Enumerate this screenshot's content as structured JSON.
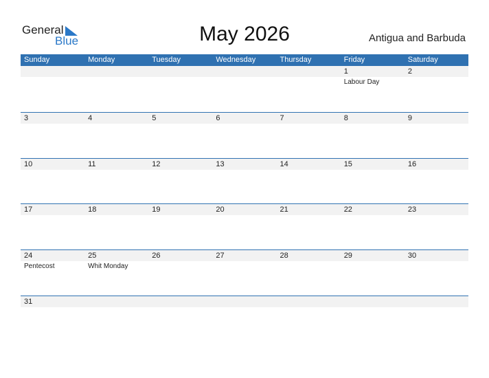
{
  "logo": {
    "general": "General",
    "blue": "Blue",
    "icon": "triangle-flag-icon"
  },
  "title": "May 2026",
  "country": "Antigua and Barbuda",
  "weekdays": [
    "Sunday",
    "Monday",
    "Tuesday",
    "Wednesday",
    "Thursday",
    "Friday",
    "Saturday"
  ],
  "weeks": [
    [
      {
        "d": ""
      },
      {
        "d": ""
      },
      {
        "d": ""
      },
      {
        "d": ""
      },
      {
        "d": ""
      },
      {
        "d": "1",
        "h": "Labour Day"
      },
      {
        "d": "2"
      }
    ],
    [
      {
        "d": "3"
      },
      {
        "d": "4"
      },
      {
        "d": "5"
      },
      {
        "d": "6"
      },
      {
        "d": "7"
      },
      {
        "d": "8"
      },
      {
        "d": "9"
      }
    ],
    [
      {
        "d": "10"
      },
      {
        "d": "11"
      },
      {
        "d": "12"
      },
      {
        "d": "13"
      },
      {
        "d": "14"
      },
      {
        "d": "15"
      },
      {
        "d": "16"
      }
    ],
    [
      {
        "d": "17"
      },
      {
        "d": "18"
      },
      {
        "d": "19"
      },
      {
        "d": "20"
      },
      {
        "d": "21"
      },
      {
        "d": "22"
      },
      {
        "d": "23"
      }
    ],
    [
      {
        "d": "24",
        "h": "Pentecost"
      },
      {
        "d": "25",
        "h": "Whit Monday"
      },
      {
        "d": "26"
      },
      {
        "d": "27"
      },
      {
        "d": "28"
      },
      {
        "d": "29"
      },
      {
        "d": "30"
      }
    ],
    [
      {
        "d": "31"
      },
      {
        "d": ""
      },
      {
        "d": ""
      },
      {
        "d": ""
      },
      {
        "d": ""
      },
      {
        "d": ""
      },
      {
        "d": ""
      }
    ]
  ]
}
